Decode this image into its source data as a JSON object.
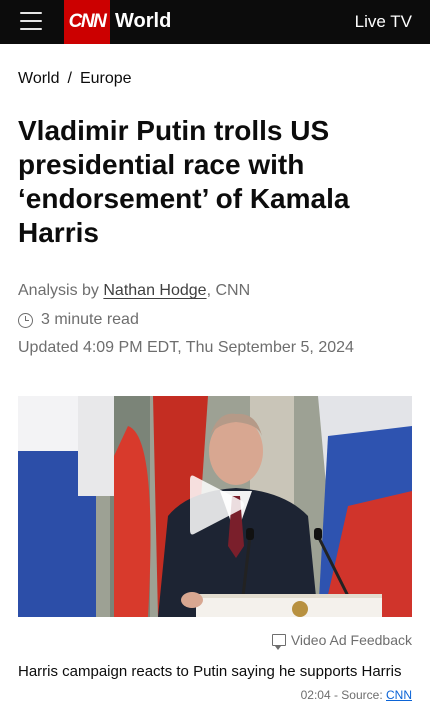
{
  "header": {
    "logo_text": "CNN",
    "section": "World",
    "live_tv": "Live TV",
    "menu_icon": "hamburger-menu-icon",
    "brand_color": "#cc0000"
  },
  "breadcrumb": {
    "items": [
      "World",
      "Europe"
    ],
    "separator": "/"
  },
  "article": {
    "headline": "Vladimir Putin trolls US presidential race with ‘endorsement’ of Kamala Harris",
    "byline_prefix": "Analysis by ",
    "author": "Nathan Hodge",
    "byline_suffix": ", CNN",
    "read_time": "3 minute read",
    "updated": "Updated 4:09 PM EDT, Thu September 5, 2024"
  },
  "video": {
    "play_icon": "play-icon",
    "ad_feedback": "Video Ad Feedback",
    "caption": "Harris campaign reacts to Putin saying he supports Harris",
    "duration": "02:04",
    "source_prefix": " - Source: ",
    "source": "CNN"
  }
}
